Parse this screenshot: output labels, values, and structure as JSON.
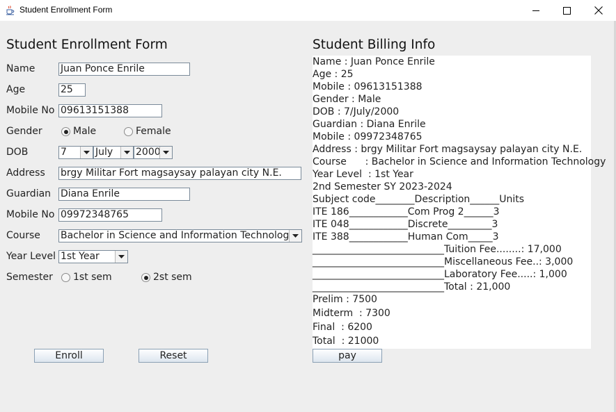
{
  "window": {
    "title": "Student Enrollment Form"
  },
  "form": {
    "heading": "Student Enrollment Form",
    "name_label": "Name",
    "name_value": "Juan Ponce Enrile",
    "age_label": "Age",
    "age_value": "25",
    "mobile_label": "Mobile No",
    "mobile_value": "09613151388",
    "gender_label": "Gender",
    "gender_options": [
      "Male",
      "Female"
    ],
    "gender_selected": "Male",
    "dob_label": "DOB",
    "dob_day": "7",
    "dob_month": "July",
    "dob_year": "2000",
    "address_label": "Address",
    "address_value": "brgy Militar Fort magsaysay palayan city N.E.",
    "guardian_label": "Guardian",
    "guardian_value": "Diana Enrile",
    "guardian_mobile_label": "Mobile No",
    "guardian_mobile_value": "09972348765",
    "course_label": "Course",
    "course_value": "Bachelor in Science and Information Technology",
    "year_level_label": "Year Level",
    "year_level_value": "1st Year",
    "semester_label": "Semester",
    "semester_options": [
      "1st sem",
      "2st sem"
    ],
    "semester_selected": "2st sem",
    "enroll_button": "Enroll",
    "reset_button": "Reset"
  },
  "billing": {
    "heading": "Student Billing Info",
    "lines": [
      "Name : Juan Ponce Enrile",
      "Age : 25",
      "Mobile : 09613151388",
      "Gender : Male",
      "DOB : 7/July/2000",
      "Guardian : Diana Enrile",
      "Mobile : 09972348765",
      "Address : brgy Militar Fort magsaysay palayan city N.E.",
      "Course      : Bachelor in Science and Information Technology",
      "Year Level  : 1st Year",
      "2nd Semester SY 2023-2024",
      "Subject code________Description______Units",
      "ITE 186____________Com Prog 2______3",
      "ITE 048____________Discrete_________3",
      "ITE 388____________Human Com_____3",
      "___________________________Tuition Fee........: 17,000",
      "___________________________Miscellaneous Fee..: 3,000",
      "___________________________Laboratory Fee.....: 1,000",
      "___________________________Total : 21,000",
      "Prelim : 7500",
      "Midterm  : 7300",
      "Final  : 6200",
      "Total  : 21000"
    ],
    "pay_button": "pay"
  },
  "icons": {
    "app": "java-coffee-cup-icon",
    "minimize": "minimize-icon",
    "maximize": "maximize-icon",
    "close": "close-icon",
    "dropdown": "chevron-down-icon"
  }
}
